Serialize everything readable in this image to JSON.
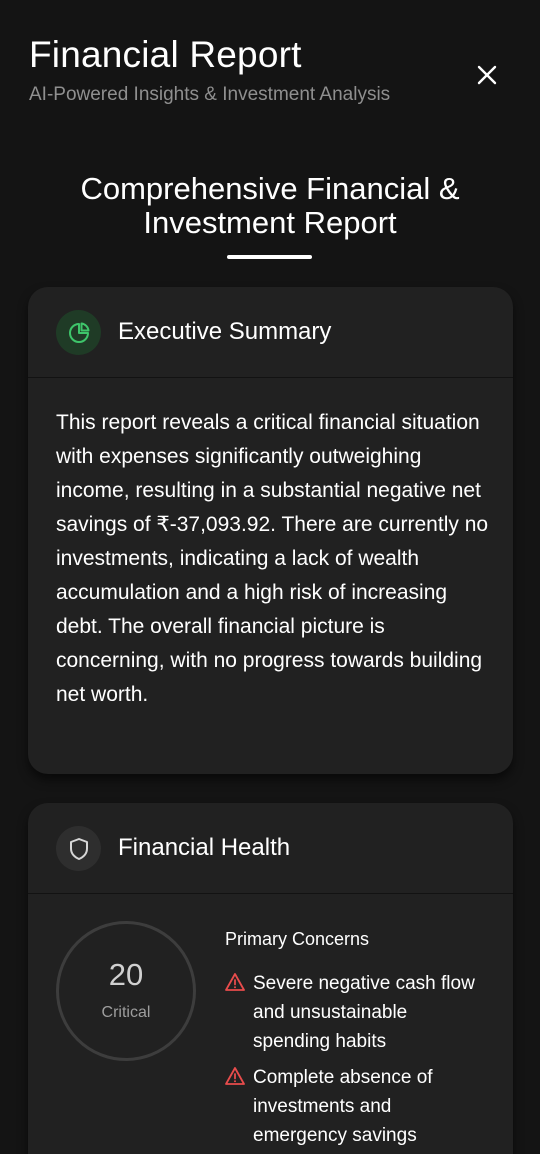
{
  "header": {
    "title": "Financial Report",
    "subtitle": "AI-Powered Insights & Investment Analysis",
    "close_icon": "close-icon"
  },
  "report": {
    "title": "Comprehensive Financial & Investment Report"
  },
  "executive_summary": {
    "title": "Executive Summary",
    "icon": "pie-chart-icon",
    "text": "This report reveals a critical financial situation with expenses significantly outweighing income, resulting in a substantial negative net savings of ₹-37,093.92. There are currently no investments, indicating a lack of wealth accumulation and a high risk of increasing debt. The overall financial picture is concerning, with no progress towards building net worth."
  },
  "financial_health": {
    "title": "Financial Health",
    "icon": "shield-icon",
    "score": "20",
    "score_label": "Critical",
    "concerns_title": "Primary Concerns",
    "concerns": [
      "Severe negative cash flow and unsustainable spending habits",
      "Complete absence of investments and emergency savings"
    ]
  },
  "colors": {
    "background": "#141414",
    "card": "#212121",
    "accent_green": "#3ec56a",
    "warning_red": "#e84c4c",
    "muted_text": "#8f8f8f"
  }
}
